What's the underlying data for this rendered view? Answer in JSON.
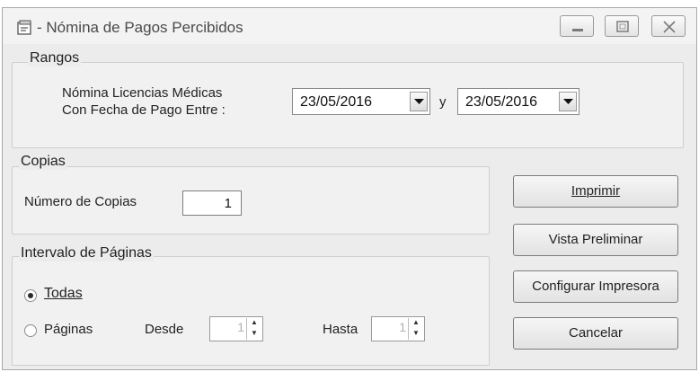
{
  "window": {
    "title": "Nómina de Pagos Percibidos",
    "title_prefix": "-"
  },
  "rangos": {
    "group_title": "Rangos",
    "label_line1": "Nómina Licencias Médicas",
    "label_line2": "Con Fecha de Pago  Entre :",
    "date_from": "23/05/2016",
    "connector": "y",
    "date_to": "23/05/2016"
  },
  "copias": {
    "group_title": "Copias",
    "label": "Número de Copias",
    "value": "1"
  },
  "intervalo": {
    "group_title": "Intervalo de Páginas",
    "option_todas_label": "Todas",
    "option_paginas_label": "Páginas",
    "selected": "todas",
    "desde_label": "Desde",
    "desde_value": "1",
    "hasta_label": "Hasta",
    "hasta_value": "1"
  },
  "buttons": {
    "imprimir": "Imprimir",
    "vista": "Vista Preliminar",
    "configurar": "Configurar Impresora",
    "cancelar": "Cancelar"
  }
}
